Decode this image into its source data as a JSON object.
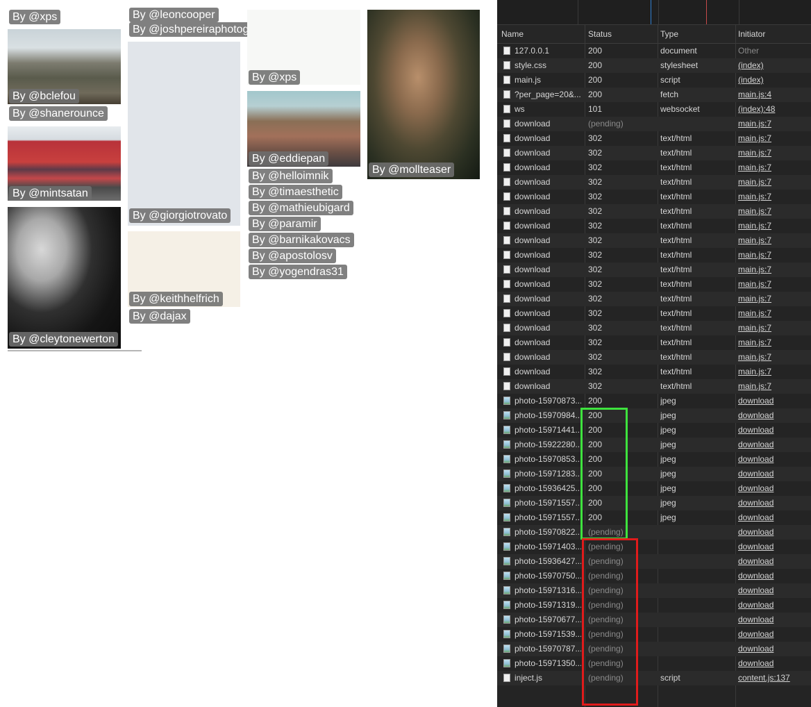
{
  "gallery": {
    "tiles": [
      {
        "photo": "none",
        "badge": "By @xps"
      },
      {
        "photo": "mountain",
        "badge": "By @bclefou"
      },
      {
        "photo": "none",
        "badge": "By @shanerounce"
      },
      {
        "photo": "train",
        "badge": "By @mintsatan"
      },
      {
        "photo": "person",
        "badge": "By @cleytonewerton"
      },
      {
        "photo": "none",
        "badge": "By @leoncooper"
      },
      {
        "photo": "none",
        "badge": "By @joshpereiraphotograp"
      },
      {
        "photo": "lightblue",
        "badge": "By @giorgiotrovato"
      },
      {
        "photo": "cream",
        "badge": "By @keithhelfrich"
      },
      {
        "photo": "none",
        "badge": "By @dajax"
      },
      {
        "photo": "pale",
        "badge": "By @xps"
      },
      {
        "photo": "street",
        "badge": "By @eddiepan"
      },
      {
        "photo": "none",
        "badge": "By @helloimnik"
      },
      {
        "photo": "none",
        "badge": "By @timaesthetic"
      },
      {
        "photo": "none",
        "badge": "By @mathieubigard"
      },
      {
        "photo": "none",
        "badge": "By @paramir"
      },
      {
        "photo": "none",
        "badge": "By @barnikakovacs"
      },
      {
        "photo": "none",
        "badge": "By @apostolosv"
      },
      {
        "photo": "none",
        "badge": "By @yogendras31"
      },
      {
        "photo": "women",
        "badge": "By @mollteaser"
      }
    ]
  },
  "devtools": {
    "columns": [
      "Name",
      "Status",
      "Type",
      "Initiator"
    ],
    "rows": [
      {
        "name": "127.0.0.1",
        "status": "200",
        "type": "document",
        "initiator": "Other",
        "icon": "doc"
      },
      {
        "name": "style.css",
        "status": "200",
        "type": "stylesheet",
        "initiator": "(index)",
        "icon": "doc"
      },
      {
        "name": "main.js",
        "status": "200",
        "type": "script",
        "initiator": "(index)",
        "icon": "doc"
      },
      {
        "name": "?per_page=20&...",
        "status": "200",
        "type": "fetch",
        "initiator": "main.js:4",
        "icon": "doc"
      },
      {
        "name": "ws",
        "status": "101",
        "type": "websocket",
        "initiator": "(index):48",
        "icon": "doc"
      },
      {
        "name": "download",
        "status": "(pending)",
        "type": "",
        "initiator": "main.js:7",
        "icon": "doc"
      },
      {
        "name": "download",
        "status": "302",
        "type": "text/html",
        "initiator": "main.js:7",
        "icon": "doc"
      },
      {
        "name": "download",
        "status": "302",
        "type": "text/html",
        "initiator": "main.js:7",
        "icon": "doc"
      },
      {
        "name": "download",
        "status": "302",
        "type": "text/html",
        "initiator": "main.js:7",
        "icon": "doc"
      },
      {
        "name": "download",
        "status": "302",
        "type": "text/html",
        "initiator": "main.js:7",
        "icon": "doc"
      },
      {
        "name": "download",
        "status": "302",
        "type": "text/html",
        "initiator": "main.js:7",
        "icon": "doc"
      },
      {
        "name": "download",
        "status": "302",
        "type": "text/html",
        "initiator": "main.js:7",
        "icon": "doc"
      },
      {
        "name": "download",
        "status": "302",
        "type": "text/html",
        "initiator": "main.js:7",
        "icon": "doc"
      },
      {
        "name": "download",
        "status": "302",
        "type": "text/html",
        "initiator": "main.js:7",
        "icon": "doc"
      },
      {
        "name": "download",
        "status": "302",
        "type": "text/html",
        "initiator": "main.js:7",
        "icon": "doc"
      },
      {
        "name": "download",
        "status": "302",
        "type": "text/html",
        "initiator": "main.js:7",
        "icon": "doc"
      },
      {
        "name": "download",
        "status": "302",
        "type": "text/html",
        "initiator": "main.js:7",
        "icon": "doc"
      },
      {
        "name": "download",
        "status": "302",
        "type": "text/html",
        "initiator": "main.js:7",
        "icon": "doc"
      },
      {
        "name": "download",
        "status": "302",
        "type": "text/html",
        "initiator": "main.js:7",
        "icon": "doc"
      },
      {
        "name": "download",
        "status": "302",
        "type": "text/html",
        "initiator": "main.js:7",
        "icon": "doc"
      },
      {
        "name": "download",
        "status": "302",
        "type": "text/html",
        "initiator": "main.js:7",
        "icon": "doc"
      },
      {
        "name": "download",
        "status": "302",
        "type": "text/html",
        "initiator": "main.js:7",
        "icon": "doc"
      },
      {
        "name": "download",
        "status": "302",
        "type": "text/html",
        "initiator": "main.js:7",
        "icon": "doc"
      },
      {
        "name": "download",
        "status": "302",
        "type": "text/html",
        "initiator": "main.js:7",
        "icon": "doc"
      },
      {
        "name": "photo-15970873...",
        "status": "200",
        "type": "jpeg",
        "initiator": "download",
        "icon": "img"
      },
      {
        "name": "photo-15970984...",
        "status": "200",
        "type": "jpeg",
        "initiator": "download",
        "icon": "img"
      },
      {
        "name": "photo-15971441...",
        "status": "200",
        "type": "jpeg",
        "initiator": "download",
        "icon": "img"
      },
      {
        "name": "photo-15922280...",
        "status": "200",
        "type": "jpeg",
        "initiator": "download",
        "icon": "img"
      },
      {
        "name": "photo-15970853...",
        "status": "200",
        "type": "jpeg",
        "initiator": "download",
        "icon": "img"
      },
      {
        "name": "photo-15971283...",
        "status": "200",
        "type": "jpeg",
        "initiator": "download",
        "icon": "img"
      },
      {
        "name": "photo-15936425...",
        "status": "200",
        "type": "jpeg",
        "initiator": "download",
        "icon": "img"
      },
      {
        "name": "photo-15971557...",
        "status": "200",
        "type": "jpeg",
        "initiator": "download",
        "icon": "img"
      },
      {
        "name": "photo-15971557...",
        "status": "200",
        "type": "jpeg",
        "initiator": "download",
        "icon": "img"
      },
      {
        "name": "photo-15970822...",
        "status": "(pending)",
        "type": "",
        "initiator": "download",
        "icon": "img"
      },
      {
        "name": "photo-15971403...",
        "status": "(pending)",
        "type": "",
        "initiator": "download",
        "icon": "img"
      },
      {
        "name": "photo-15936427...",
        "status": "(pending)",
        "type": "",
        "initiator": "download",
        "icon": "img"
      },
      {
        "name": "photo-15970750...",
        "status": "(pending)",
        "type": "",
        "initiator": "download",
        "icon": "img"
      },
      {
        "name": "photo-15971316...",
        "status": "(pending)",
        "type": "",
        "initiator": "download",
        "icon": "img"
      },
      {
        "name": "photo-15971319...",
        "status": "(pending)",
        "type": "",
        "initiator": "download",
        "icon": "img"
      },
      {
        "name": "photo-15970677...",
        "status": "(pending)",
        "type": "",
        "initiator": "download",
        "icon": "img"
      },
      {
        "name": "photo-15971539...",
        "status": "(pending)",
        "type": "",
        "initiator": "download",
        "icon": "img"
      },
      {
        "name": "photo-15970787...",
        "status": "(pending)",
        "type": "",
        "initiator": "download",
        "icon": "img"
      },
      {
        "name": "photo-15971350...",
        "status": "(pending)",
        "type": "",
        "initiator": "download",
        "icon": "img"
      },
      {
        "name": "inject.js",
        "status": "(pending)",
        "type": "script",
        "initiator": "content.js:137",
        "icon": "doc"
      }
    ],
    "highlight_colors": {
      "loaded": "#3ee33e",
      "pending": "#e01b1b"
    }
  }
}
